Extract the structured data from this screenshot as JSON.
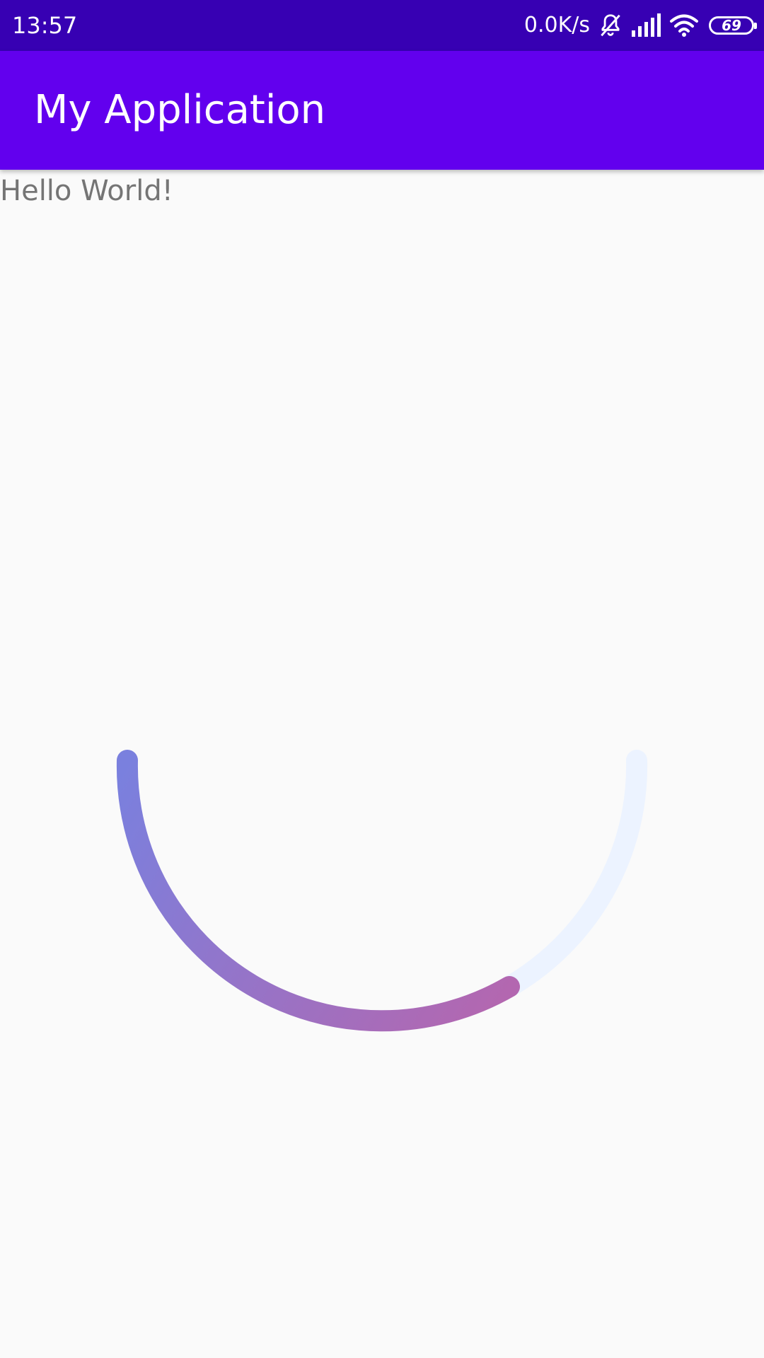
{
  "status_bar": {
    "time": "13:57",
    "net_speed": "0.0K/s",
    "icons": [
      "bell-off-icon",
      "signal-icon",
      "wifi-icon",
      "battery-icon"
    ],
    "battery_level": "69"
  },
  "app_bar": {
    "title": "My Application",
    "color": "#6200ee"
  },
  "content": {
    "text": "Hello World!"
  },
  "progress": {
    "type": "circular-indeterminate",
    "start_color": "#7a80de",
    "end_color": "#b367b0",
    "track_color": "#eaf2ff"
  }
}
